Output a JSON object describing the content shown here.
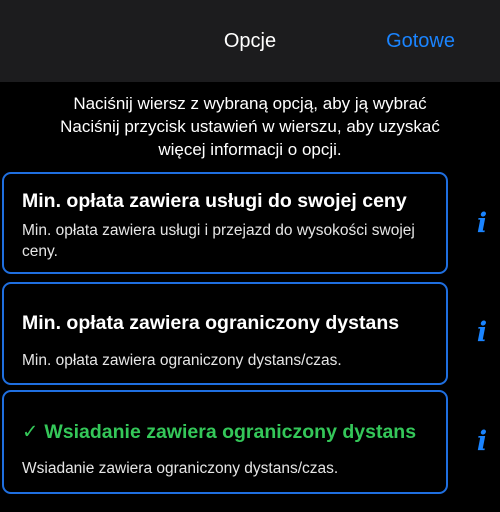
{
  "navbar": {
    "title": "Opcje",
    "done_label": "Gotowe"
  },
  "instructions": {
    "line1": "Naciśnij wiersz z wybraną opcją, aby ją wybrać",
    "line2": "Naciśnij przycisk ustawień w wierszu, aby uzyskać",
    "line3": "więcej informacji o opcji."
  },
  "options": [
    {
      "title": "Min. opłata zawiera usługi do swojej ceny",
      "description": "Min. opłata zawiera usługi i przejazd do wysokości swojej ceny.",
      "selected": false
    },
    {
      "title": "Min. opłata zawiera ograniczony dystans",
      "description": "Min. opłata zawiera ograniczony dystans/czas.",
      "selected": false
    },
    {
      "title": "Wsiadanie zawiera ograniczony dystans",
      "description": "Wsiadanie zawiera ograniczony dystans/czas.",
      "selected": true,
      "check_glyph": "✓"
    }
  ],
  "info_glyph": "i",
  "colors": {
    "background": "#000000",
    "navbar": "#1c1c1e",
    "accent": "#1a84ff",
    "border": "#1f6fe0",
    "selected": "#34c759"
  },
  "icons": {
    "info": "info-icon",
    "check": "checkmark-icon"
  }
}
